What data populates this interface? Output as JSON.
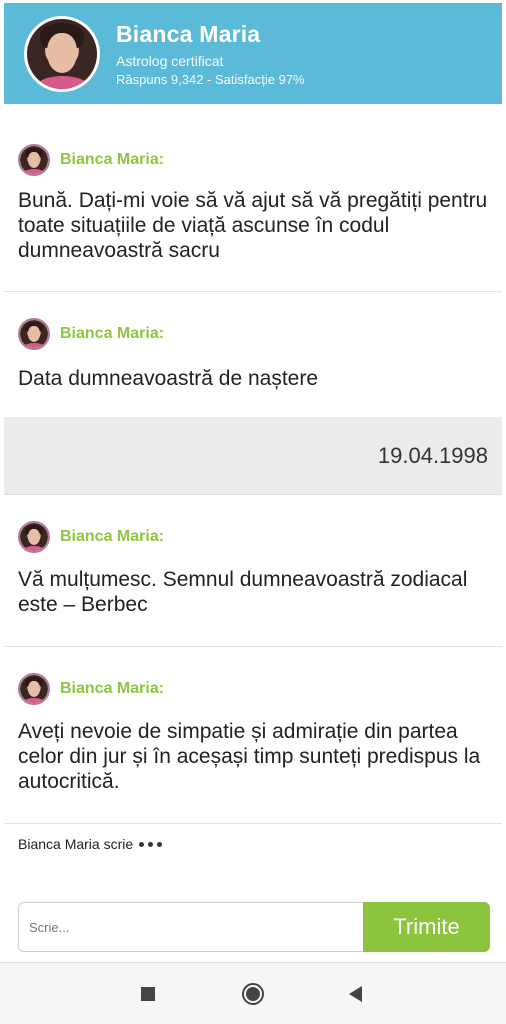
{
  "header": {
    "name": "Bianca Maria",
    "role": "Astrolog certificat",
    "stats": "Răspuns 9,342 - Satisfacție 97%",
    "color": "#5bbad8"
  },
  "messages": [
    {
      "sender": "Bianca Maria:",
      "text": "Bună. Dați-mi voie să vă ajut să vă pregătiți pentru toate situațiile de viață ascunse în codul dumneavoastră sacru"
    },
    {
      "sender": "Bianca Maria:",
      "text": "Data dumneavoastră de naștere"
    },
    {
      "sender": "Bianca Maria:",
      "text": "Vă mulțumesc. Semnul dumneavoastră zodiacal este – Berbec"
    },
    {
      "sender": "Bianca Maria:",
      "text": "Aveți nevoie de simpatie și admirație din partea celor din jur și în aceșași timp sunteți predispus la autocritică."
    }
  ],
  "user_reply": {
    "text": "19.04.1998"
  },
  "typing": {
    "text": "Bianca Maria scrie"
  },
  "composer": {
    "placeholder": "Scrie...",
    "send_label": "Trimite",
    "accent": "#8cc43e"
  },
  "navbar": {
    "icons": [
      "recents-square-icon",
      "home-circle-icon",
      "back-triangle-icon"
    ]
  }
}
